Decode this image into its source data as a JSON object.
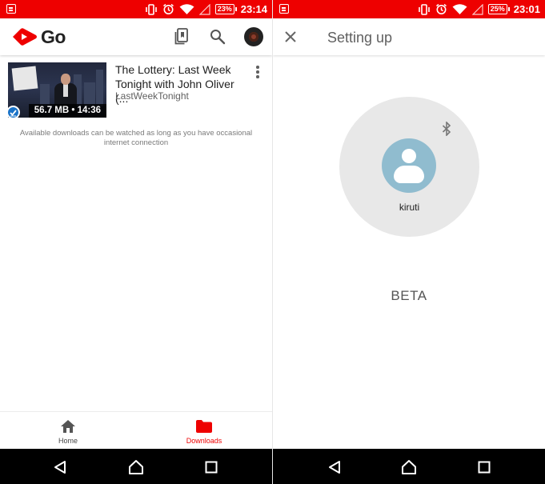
{
  "left": {
    "status": {
      "battery": "23%",
      "time": "23:14"
    },
    "app": {
      "logo_text": "Go"
    },
    "video": {
      "title": "The Lottery: Last Week\nTonight with John Oliver (...",
      "channel": "LastWeekTonight",
      "meta": "56.7 MB • 14:36"
    },
    "note": "Available downloads can be watched as long as you have occasional internet connection",
    "nav": {
      "home": "Home",
      "downloads": "Downloads"
    }
  },
  "right": {
    "status": {
      "battery": "25%",
      "time": "23:01"
    },
    "title": "Setting up",
    "username": "kiruti",
    "beta": "BETA"
  },
  "colors": {
    "accent": "#ee0000",
    "avatar": "#90bccf",
    "check": "#1a73c8"
  },
  "icons": [
    "notification-icon",
    "vibrate-icon",
    "alarm-icon",
    "wifi-icon",
    "signal-icon",
    "battery-icon",
    "go-logo-icon",
    "library-icon",
    "search-icon",
    "account-avatar",
    "more-vert-icon",
    "download-check-icon",
    "home-icon",
    "folder-icon",
    "back-icon",
    "home-circle-icon",
    "recents-icon",
    "close-icon",
    "bluetooth-icon",
    "person-icon"
  ]
}
